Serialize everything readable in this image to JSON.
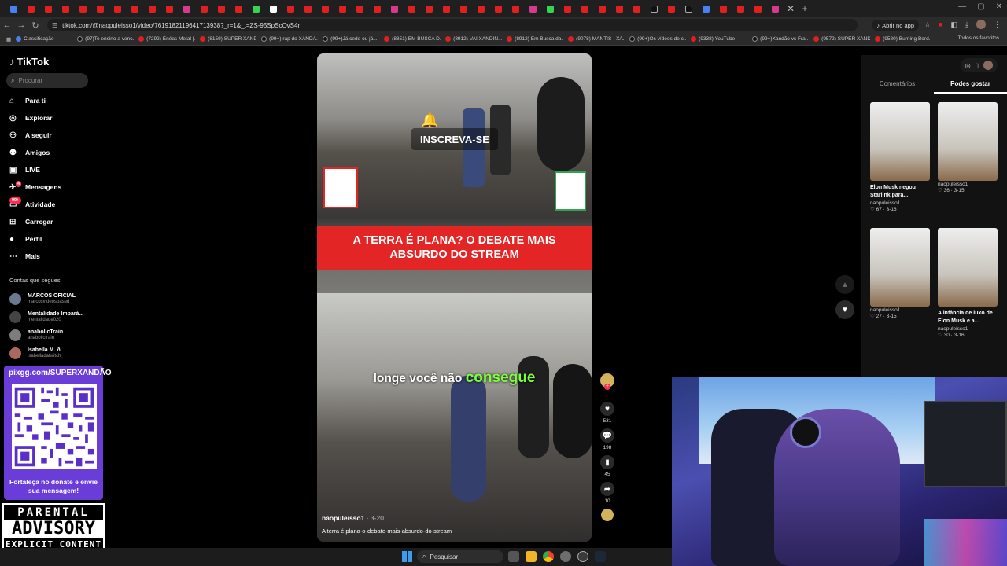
{
  "browser": {
    "url": "tiktok.com/@naopuleisso1/video/7619182119641713938?_r=1&_t=ZS-95SpScOvS4r",
    "open_in_app": "Abrir no app",
    "bookmarks": [
      {
        "label": "Classificação",
        "kind": "blue"
      },
      {
        "label": "(97)Te ensino a venc...",
        "kind": "tt"
      },
      {
        "label": "(7292) Enéas Metal |...",
        "kind": "yt"
      },
      {
        "label": "(8159) SUPER XAND...",
        "kind": "yt"
      },
      {
        "label": "(99+)Irap do XANDÃ...",
        "kind": "tt"
      },
      {
        "label": "(99+)Já cedo ou já...",
        "kind": "tt"
      },
      {
        "label": "(8851) EM BUSCA D...",
        "kind": "yt"
      },
      {
        "label": "(8912) VAI XANDIN...",
        "kind": "yt"
      },
      {
        "label": "(8912) Em Busca da...",
        "kind": "yt"
      },
      {
        "label": "(9078) MANTIS - XA...",
        "kind": "yt"
      },
      {
        "label": "(99+)Os vídeos de c...",
        "kind": "tt"
      },
      {
        "label": "(9338) YouTube",
        "kind": "yt"
      },
      {
        "label": "(99+)Xandão vs Fra...",
        "kind": "tt"
      },
      {
        "label": "(9572) SUPER XAND...",
        "kind": "yt"
      },
      {
        "label": "(9580) Burning Bord...",
        "kind": "yt"
      }
    ],
    "all_bookmarks": "Todos os favoritos"
  },
  "sidebar": {
    "logo": "TikTok",
    "search_placeholder": "Procurar",
    "nav": [
      {
        "label": "Para ti",
        "icon": "home-icon"
      },
      {
        "label": "Explorar",
        "icon": "compass-icon"
      },
      {
        "label": "A seguir",
        "icon": "following-icon"
      },
      {
        "label": "Amigos",
        "icon": "friends-icon"
      },
      {
        "label": "LIVE",
        "icon": "live-icon"
      },
      {
        "label": "Mensagens",
        "icon": "messages-icon",
        "badge": "4"
      },
      {
        "label": "Atividade",
        "icon": "activity-icon",
        "badge": "99+"
      },
      {
        "label": "Carregar",
        "icon": "upload-icon"
      },
      {
        "label": "Perfil",
        "icon": "profile-icon"
      },
      {
        "label": "Mais",
        "icon": "more-icon"
      }
    ],
    "following_heading": "Contas que segues",
    "following": [
      {
        "name": "MARCOS OFICIAL",
        "handle": "marcosvideosbased"
      },
      {
        "name": "Mentalidade Impará...",
        "handle": "mentalidade020"
      },
      {
        "name": "anabolicTrain",
        "handle": "anabolictrain"
      },
      {
        "name": "Isabella M. ð",
        "handle": "isabelladatwitch"
      }
    ]
  },
  "overlay": {
    "pix_url": "pixgg.com/SUPERXANDÃO",
    "pix_message": "Fortaleça no donate e envie sua mensagem!",
    "advisory_line1": "PARENTAL",
    "advisory_line2": "ADVISORY",
    "advisory_line3": "EXPLICIT CONTENT"
  },
  "video": {
    "banner": "A TERRA É PLANA? O DEBATE MAIS ABSURDO DO STREAM",
    "subscribe": "INSCREVA-SE",
    "caption_text": "longe você não",
    "caption_highlight": "consegue",
    "author": "naopuleisso1",
    "date": "3-20",
    "description": "A terra é plana-o-debate-mais-absurdo-do-stream"
  },
  "actions": {
    "likes": "531",
    "comments": "198",
    "saves": "45",
    "shares": "10"
  },
  "right_panel": {
    "tabs": [
      "Comentários",
      "Podes gostar"
    ],
    "active_tab": "Podes gostar",
    "cards": [
      {
        "title": "Elon Musk negou Starlink para...",
        "author": "naopuleisso1",
        "likes": "67",
        "date": "3-16"
      },
      {
        "title": "",
        "author": "naopuleisso1",
        "likes": "36",
        "date": "3-15"
      },
      {
        "title": "",
        "author": "naopuleisso1",
        "likes": "27",
        "date": "3-15"
      },
      {
        "title": "A infância de luxo de Elon Musk e a...",
        "author": "naopuleisso1",
        "likes": "30",
        "date": "3-16"
      }
    ]
  },
  "taskbar": {
    "search": "Pesquisar"
  },
  "colors": {
    "tiktok_red": "#fe2c55",
    "banner_red": "#e32526",
    "caption_green": "#7dff3a",
    "pix_purple": "#6a3cd8"
  }
}
